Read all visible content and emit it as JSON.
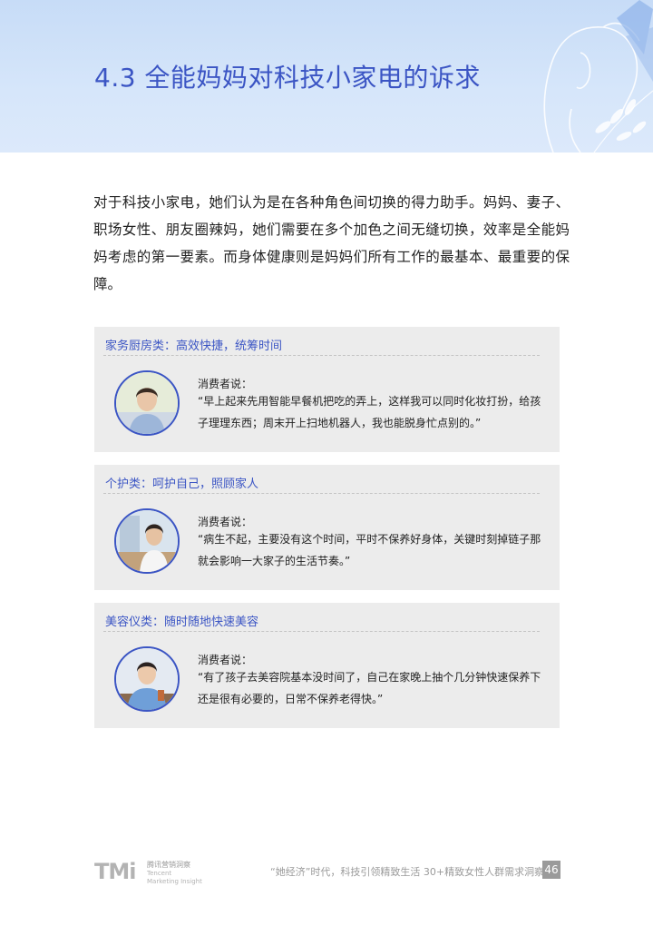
{
  "header": {
    "title": "4.3 全能妈妈对科技小家电的诉求"
  },
  "intro": "对于科技小家电，她们认为是在各种角色间切换的得力助手。妈妈、妻子、职场女性、朋友圈辣妈，她们需要在多个加色之间无缝切换，效率是全能妈妈考虑的第一要素。而身体健康则是妈妈们所有工作的最基本、最重要的保障。",
  "cards": [
    {
      "title": "家务厨房类：高效快捷，统筹时间",
      "label": "消费者说：",
      "quote": "“早上起来先用智能早餐机把吃的弄上，这样我可以同时化妆打扮，给孩子理理东西；周末开上扫地机器人，我也能脱身忙点别的。”"
    },
    {
      "title": "个护类：呵护自己，照顾家人",
      "label": "消费者说：",
      "quote": "“病生不起，主要没有这个时间，平时不保养好身体，关键时刻掉链子那就会影响一大家子的生活节奏。”"
    },
    {
      "title": "美容仪类：随时随地快速美容",
      "label": "消费者说：",
      "quote": "“有了孩子去美容院基本没时间了，自己在家晚上抽个几分钟快速保养下还是很有必要的，日常不保养老得快。”"
    }
  ],
  "footer": {
    "logo_text": "TMi",
    "brand_cn": "腾讯营销洞察",
    "brand_en_1": "Tencent",
    "brand_en_2": "Marketing Insight",
    "report_title": "“她经济”时代，科技引领精致生活 30+精致女性人群需求洞察",
    "page_number": "46"
  },
  "colors": {
    "accent": "#3b55c4",
    "header_bg": "#d6e6fa",
    "card_bg": "#ececec",
    "footer_gray": "#9a9a9a"
  }
}
